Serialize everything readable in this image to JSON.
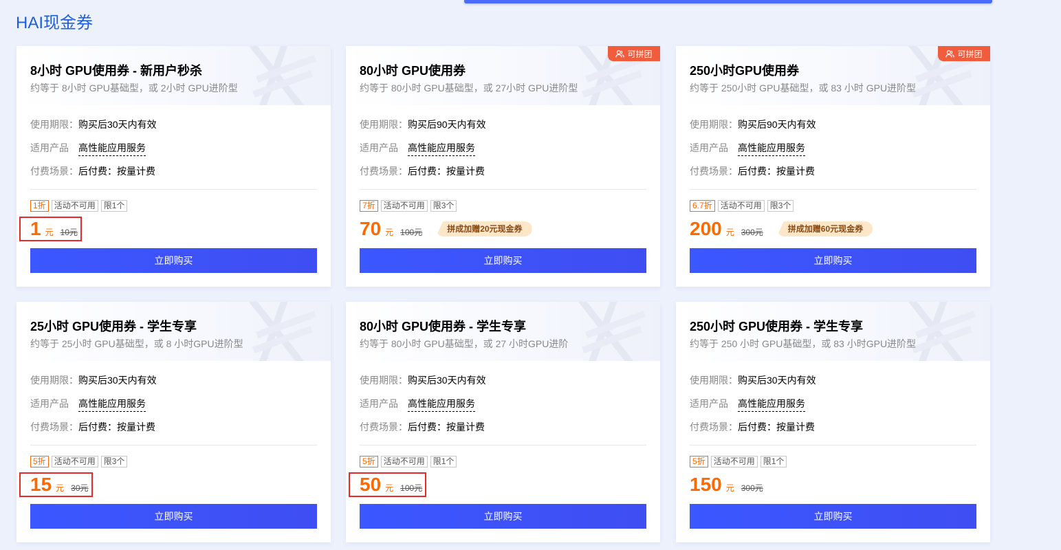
{
  "section_title": "HAI现金券",
  "labels": {
    "validity": "使用期限：",
    "product": "适用产品",
    "billing": "付费场景：",
    "buy": "立即购买",
    "group": "可拼团",
    "activity": "活动不可用",
    "currency": "元"
  },
  "colors": {
    "accent": "#ff6a00",
    "button": "#3b57ff",
    "ribbon": "#f15c3c",
    "title": "#1e5fdc"
  },
  "cards": [
    {
      "title": "8小时 GPU使用券 - 新用户秒杀",
      "subtitle": "约等于 8小时 GPU基础型，或 2小时 GPU进阶型",
      "validity": "购买后30天内有效",
      "product": "高性能应用服务",
      "billing": "后付费：按量计费",
      "discount": "1折",
      "limit": "限1个",
      "price": "1",
      "original": "10元",
      "group": false,
      "promo": "",
      "highlighted": true
    },
    {
      "title": "80小时 GPU使用券",
      "subtitle": "约等于 80小时 GPU基础型，或 27小时 GPU进阶型",
      "validity": "购买后90天内有效",
      "product": "高性能应用服务",
      "billing": "后付费：按量计费",
      "discount": "7折",
      "limit": "限3个",
      "price": "70",
      "original": "100元",
      "group": true,
      "promo": "拼成加赠20元现金券",
      "highlighted": false
    },
    {
      "title": "250小时GPU使用券",
      "subtitle": "约等于 250小时 GPU基础型，或 83 小时 GPU进阶型",
      "validity": "购买后90天内有效",
      "product": "高性能应用服务",
      "billing": "后付费：按量计费",
      "discount": "6.7折",
      "limit": "限3个",
      "price": "200",
      "original": "300元",
      "group": true,
      "promo": "拼成加赠60元现金券",
      "highlighted": false
    },
    {
      "title": "25小时 GPU使用券 - 学生专享",
      "subtitle": "约等于 25小时 GPU基础型，或 8 小时GPU进阶型",
      "validity": "购买后30天内有效",
      "product": "高性能应用服务",
      "billing": "后付费：按量计费",
      "discount": "5折",
      "limit": "限3个",
      "price": "15",
      "original": "30元",
      "group": false,
      "promo": "",
      "highlighted": true
    },
    {
      "title": "80小时 GPU使用券 - 学生专享",
      "subtitle": "约等于 80小时 GPU基础型，或 27 小时GPU进阶",
      "validity": "购买后30天内有效",
      "product": "高性能应用服务",
      "billing": "后付费：按量计费",
      "discount": "5折",
      "limit": "限1个",
      "price": "50",
      "original": "100元",
      "group": false,
      "promo": "",
      "highlighted": true
    },
    {
      "title": "250小时 GPU使用券 - 学生专享",
      "subtitle": "约等于 250 小时 GPU基础型，或 83 小时GPU进阶型",
      "validity": "购买后30天内有效",
      "product": "高性能应用服务",
      "billing": "后付费：按量计费",
      "discount": "5折",
      "limit": "限1个",
      "price": "150",
      "original": "300元",
      "group": false,
      "promo": "",
      "highlighted": false
    }
  ]
}
